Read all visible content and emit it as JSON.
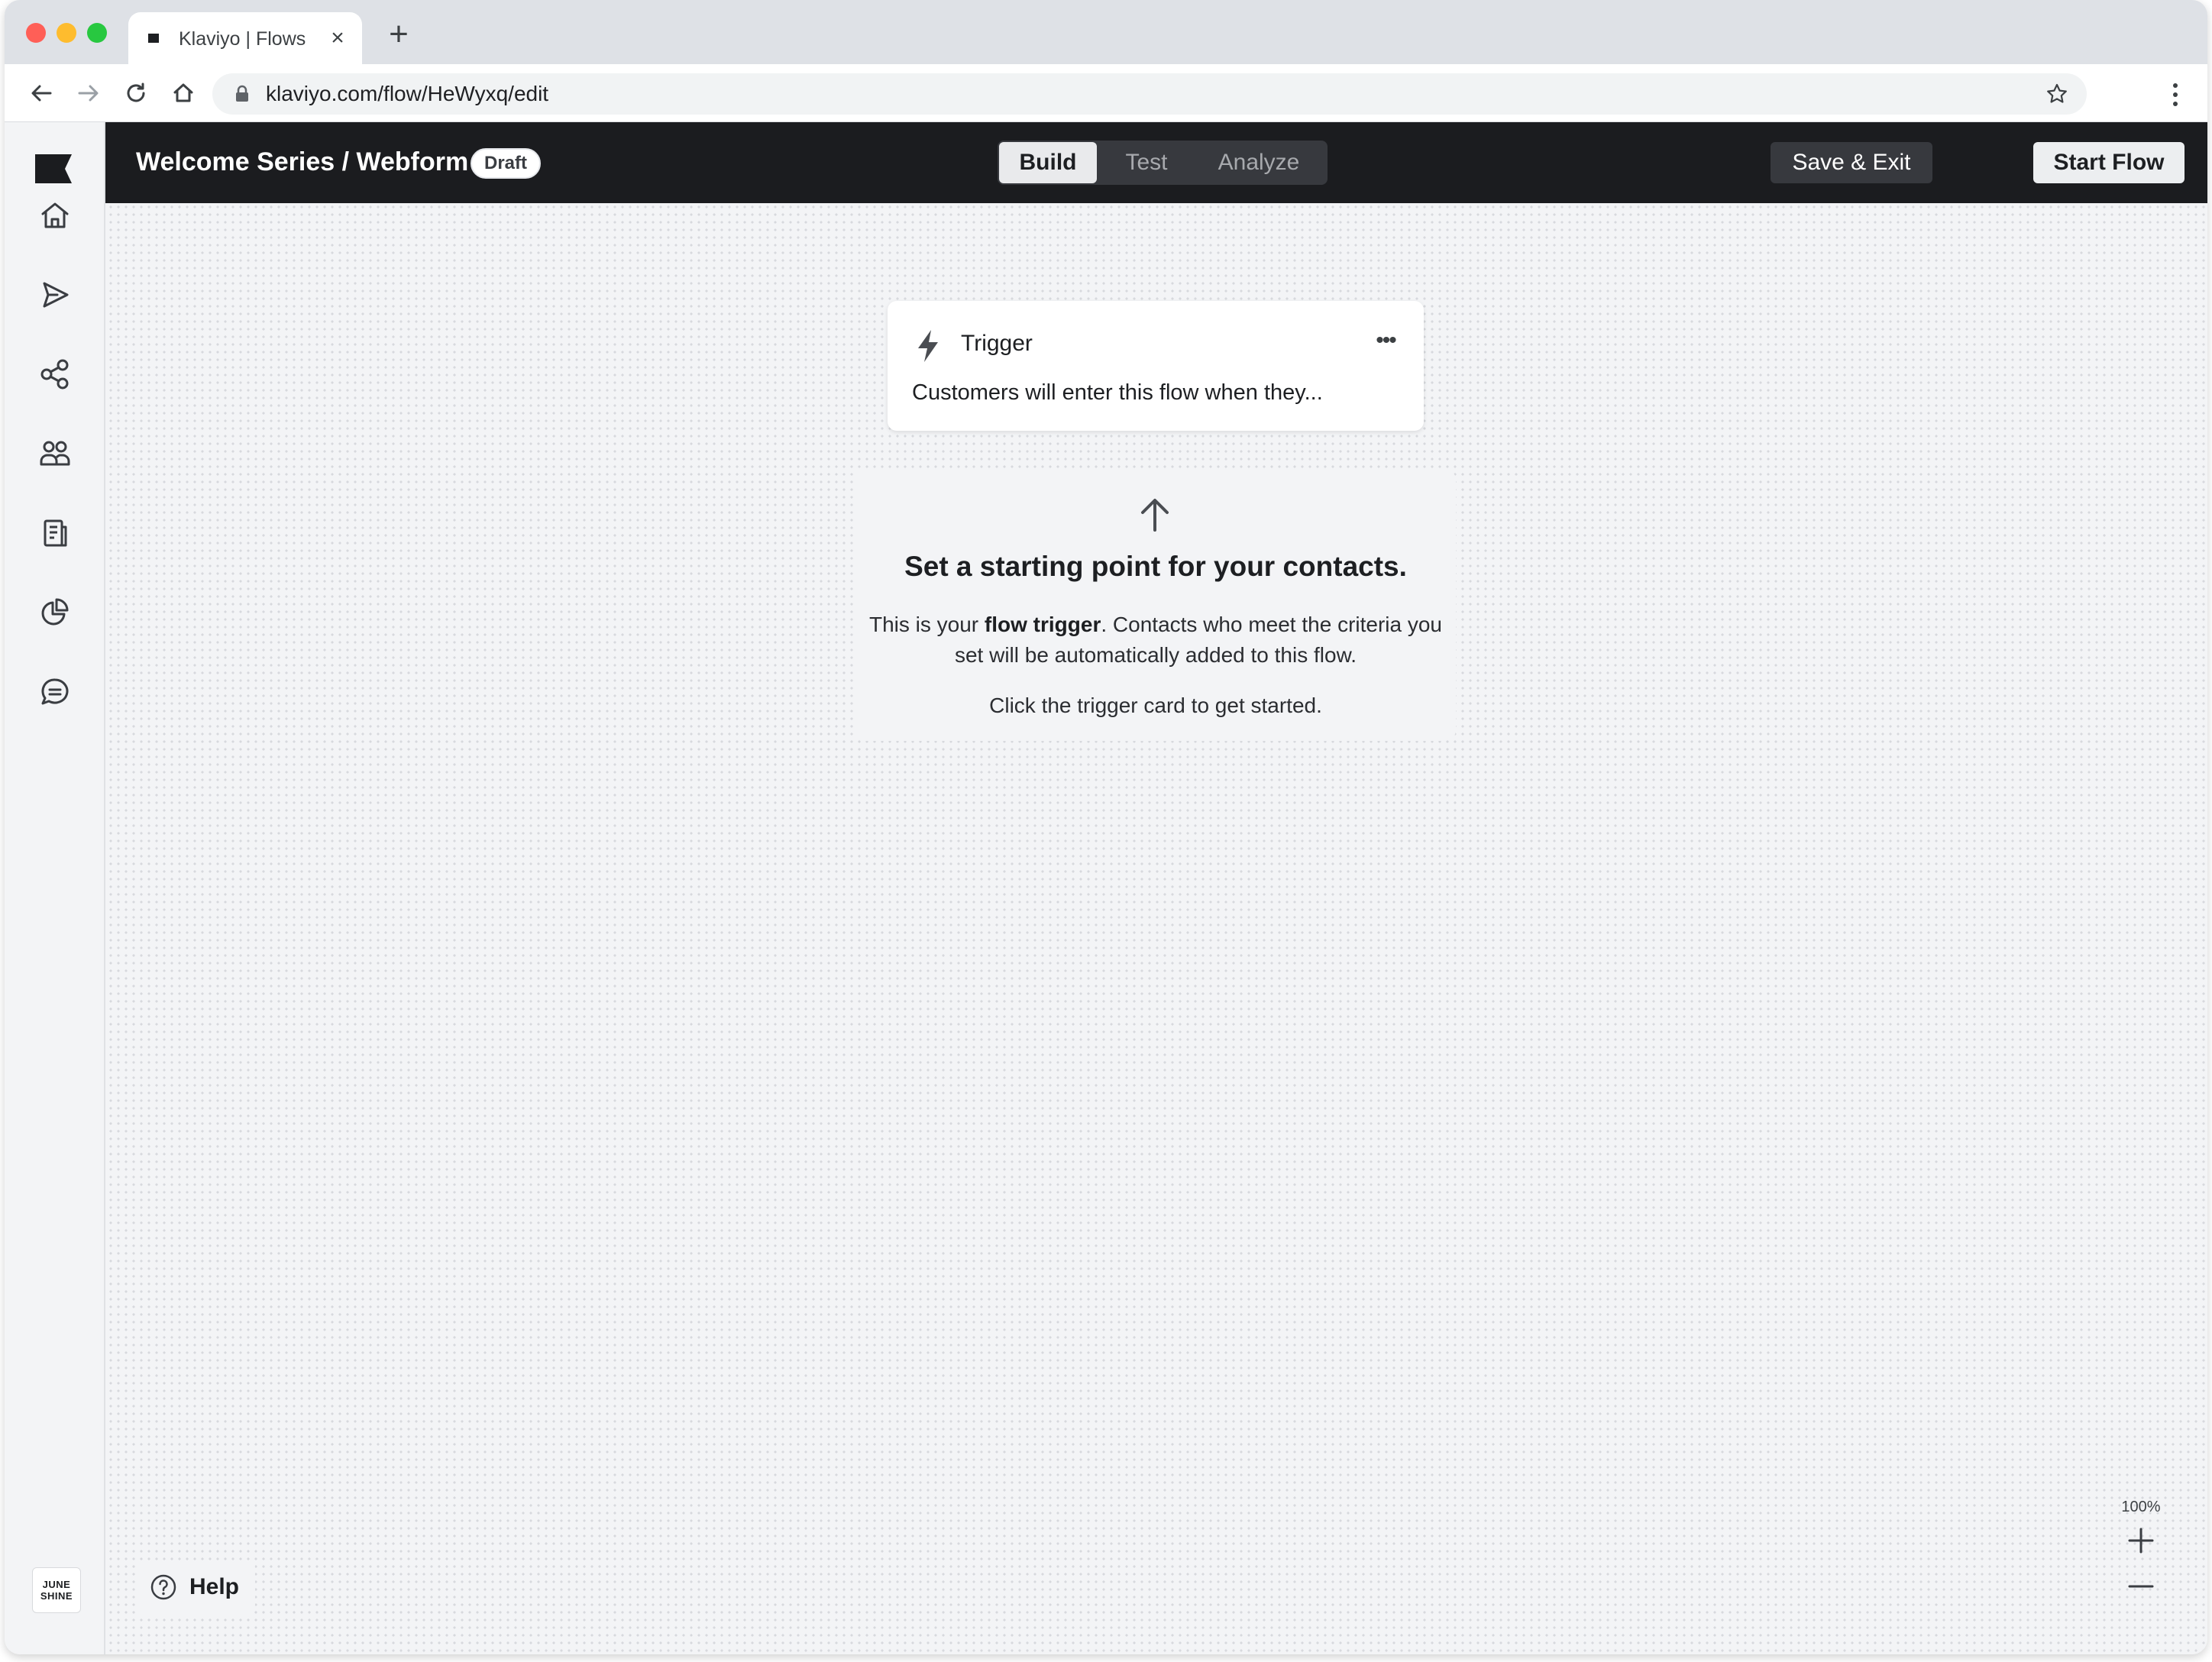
{
  "browser": {
    "tab_title": "Klaviyo | Flows",
    "tab_close": "×",
    "new_tab": "+",
    "url": "klaviyo.com/flow/HeWyxq/edit"
  },
  "header": {
    "flow_title": "Welcome Series / Webform",
    "status_badge": "Draft",
    "tabs": [
      {
        "label": "Build",
        "active": true
      },
      {
        "label": "Test",
        "active": false
      },
      {
        "label": "Analyze",
        "active": false
      }
    ],
    "save_exit_label": "Save & Exit",
    "start_flow_label": "Start Flow"
  },
  "sidebar": {
    "items": [
      {
        "icon": "home-icon"
      },
      {
        "icon": "send-icon"
      },
      {
        "icon": "flows-icon"
      },
      {
        "icon": "audience-icon"
      },
      {
        "icon": "content-icon"
      },
      {
        "icon": "analytics-icon"
      },
      {
        "icon": "conversations-icon"
      }
    ],
    "brand_line1": "JUNE",
    "brand_line2": "SHINE"
  },
  "trigger_card": {
    "title": "Trigger",
    "more": "•••",
    "description": "Customers will enter this flow when they..."
  },
  "hint": {
    "title": "Set a starting point for your contacts.",
    "body_prefix": "This is your ",
    "body_bold": "flow trigger",
    "body_suffix": ". Contacts who meet the criteria you set will be automatically added to this flow.",
    "cta": "Click the trigger card to get started."
  },
  "help_label": "Help",
  "zoom_level": "100%",
  "colors": {
    "topbar": "#1b1c1f",
    "canvas": "#f3f4f6",
    "accent_button": "#eceef0"
  }
}
